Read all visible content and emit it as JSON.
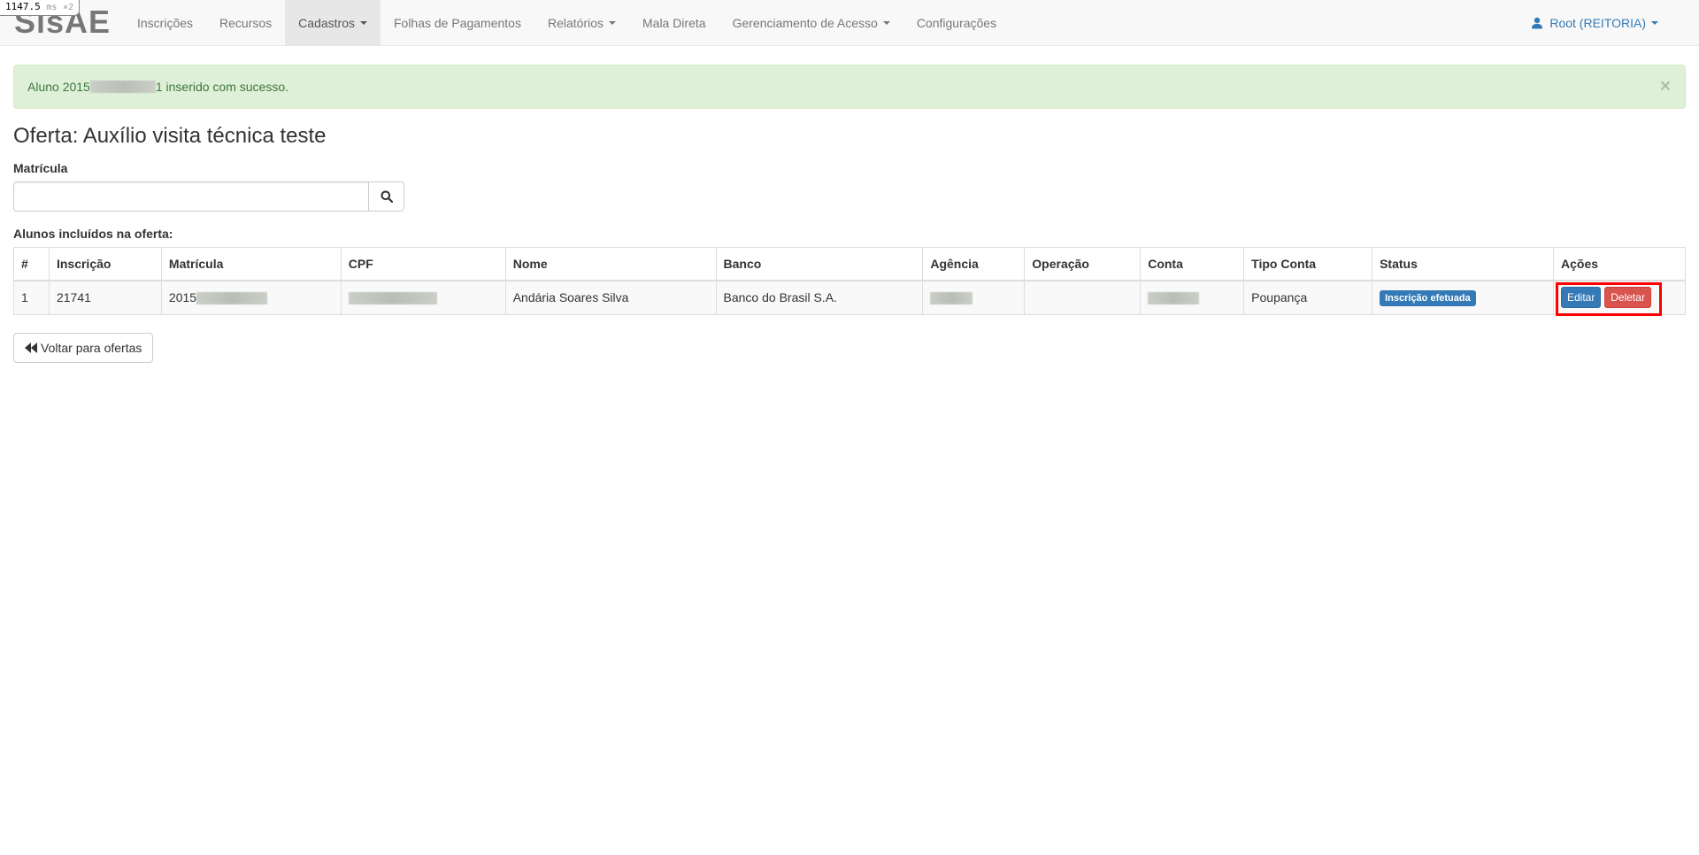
{
  "debug": {
    "timer_value": "1147.5",
    "timer_unit": "ms",
    "timer_mult": "×2"
  },
  "navbar": {
    "brand": "SisAE",
    "items": [
      {
        "label": "Inscrições"
      },
      {
        "label": "Recursos"
      },
      {
        "label": "Cadastros"
      },
      {
        "label": "Folhas de Pagamentos"
      },
      {
        "label": "Relatórios"
      },
      {
        "label": "Mala Direta"
      },
      {
        "label": "Gerenciamento de Acesso"
      },
      {
        "label": "Configurações"
      }
    ],
    "user": "Root (REITORIA)",
    "user_icon": "user-icon"
  },
  "alert": {
    "prefix": "Aluno 2015",
    "suffix": "1 inserido com sucesso.",
    "close": "×",
    "color": "#dff0d8"
  },
  "page": {
    "title": "Oferta: Auxílio visita técnica teste",
    "matricula_label": "Matrícula",
    "search_value": "",
    "search_icon": "search-icon",
    "table_caption": "Alunos incluídos na oferta:",
    "back_label": "Voltar para ofertas",
    "back_icon": "backward-icon"
  },
  "table": {
    "headers": [
      "#",
      "Inscrição",
      "Matrícula",
      "CPF",
      "Nome",
      "Banco",
      "Agência",
      "Operação",
      "Conta",
      "Tipo Conta",
      "Status",
      "Ações"
    ],
    "rows": [
      {
        "num": "1",
        "inscricao": "21741",
        "matricula": "2015",
        "cpf": "",
        "nome": "Andária Soares Silva",
        "banco": "Banco do Brasil S.A.",
        "agencia": "",
        "operacao": "",
        "conta": "",
        "tipo_conta": "Poupança",
        "status": "Inscrição efetuada",
        "edit_label": "Editar",
        "delete_label": "Deletar"
      }
    ]
  },
  "colors": {
    "primary": "#337ab7",
    "danger": "#d9534f",
    "highlight": "#ff0000"
  }
}
